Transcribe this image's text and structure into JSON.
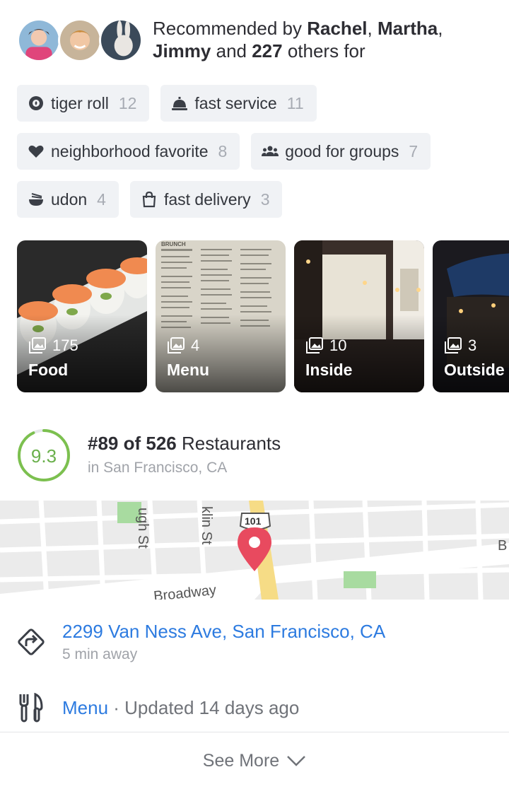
{
  "recommended": {
    "prefix": "Recommended by ",
    "name1": "Rachel",
    "sep1": ", ",
    "name2": "Martha",
    "sep2": ",",
    "name3": "Jimmy",
    "mid": " and ",
    "others_count": "227",
    "suffix": " others for"
  },
  "tags": [
    {
      "label": "tiger roll",
      "count": "12",
      "icon": "sushi-roll-icon"
    },
    {
      "label": "fast service",
      "count": "11",
      "icon": "service-bell-icon"
    },
    {
      "label": "neighborhood favorite",
      "count": "8",
      "icon": "heart-icon"
    },
    {
      "label": "good for groups",
      "count": "7",
      "icon": "group-icon"
    },
    {
      "label": "udon",
      "count": "4",
      "icon": "noodle-bowl-icon"
    },
    {
      "label": "fast delivery",
      "count": "3",
      "icon": "shopping-bag-icon"
    }
  ],
  "photos": [
    {
      "count": "175",
      "label": "Food"
    },
    {
      "count": "4",
      "label": "Menu"
    },
    {
      "count": "10",
      "label": "Inside"
    },
    {
      "count": "3",
      "label": "Outside"
    }
  ],
  "photo_menu_heading": "BRUNCH",
  "rating": {
    "score": "9.3",
    "score_fraction": 0.93,
    "rank": "#89 of 526",
    "category": " Restaurants",
    "location": "in San Francisco, CA",
    "color": "#7cc04f"
  },
  "map": {
    "labels": [
      "ugh St",
      "klin St",
      "101",
      "Broadway",
      "B"
    ],
    "pin_color": "#e84a5f"
  },
  "address": {
    "line": "2299 Van Ness Ave, San Francisco, CA",
    "distance": "5 min away",
    "icon": "directions-icon"
  },
  "menu": {
    "link": "Menu",
    "separator": " · ",
    "updated": "Updated 14 days ago",
    "icon": "fork-knife-icon"
  },
  "see_more": {
    "label": "See More",
    "icon": "chevron-down-icon"
  },
  "colors": {
    "link": "#2d7be0",
    "chip_bg": "#f0f2f5",
    "muted": "#a0a3a9"
  }
}
